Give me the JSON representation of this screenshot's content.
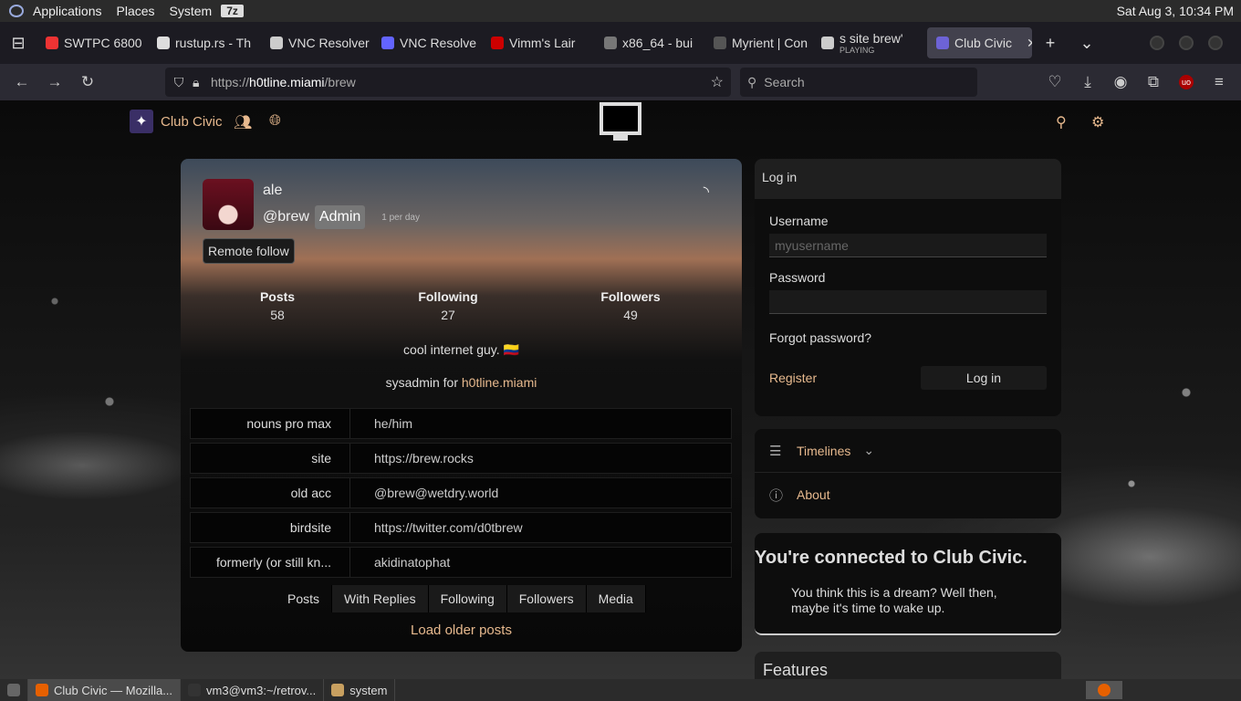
{
  "os_panel": {
    "menus": [
      "Applications",
      "Places",
      "System"
    ],
    "seven_z": "7z",
    "clock": "Sat Aug  3, 10:34 PM"
  },
  "tabs": [
    {
      "label": "SWTPC 6800",
      "color": "#e33"
    },
    {
      "label": "rustup.rs - Th",
      "color": "#ddd"
    },
    {
      "label": "VNC Resolver",
      "color": "#ccc"
    },
    {
      "label": "VNC Resolve",
      "color": "#6364ff"
    },
    {
      "label": "Vimm's Lair",
      "color": "#c00"
    },
    {
      "label": "x86_64 - bui",
      "color": "#777"
    },
    {
      "label": "Myrient | Con",
      "color": "#555"
    },
    {
      "label": "s site brew'",
      "sub": "PLAYING",
      "color": "#ccc"
    },
    {
      "label": "Club Civic",
      "color": "#6d63d6",
      "active": true
    }
  ],
  "navbar": {
    "url_prefix": "https://",
    "url_host": "h0tline.miami",
    "url_path": "/brew",
    "search_placeholder": "Search"
  },
  "site": {
    "brand": "Club Civic"
  },
  "profile": {
    "name": "ale",
    "handle": "@brew",
    "role": "Admin",
    "rate": "1 per day",
    "remote_follow": "Remote follow",
    "stats": [
      {
        "label": "Posts",
        "value": "58"
      },
      {
        "label": "Following",
        "value": "27"
      },
      {
        "label": "Followers",
        "value": "49"
      }
    ],
    "bio_line1": "cool internet guy. 🇨🇴",
    "bio_line2_prefix": "sysadmin for ",
    "bio_line2_link": "h0tline.miami",
    "fields": [
      {
        "key": "nouns pro max",
        "value": "he/him",
        "link": false
      },
      {
        "key": "site",
        "value": "https://brew.rocks",
        "link": true
      },
      {
        "key": "old acc",
        "value": "@brew@wetdry.world",
        "link": true
      },
      {
        "key": "birdsite",
        "value": "https://twitter.com/d0tbrew",
        "link": true
      },
      {
        "key": "formerly (or still kn...",
        "value": "akidinatophat",
        "link": false
      }
    ],
    "tabs": [
      "Posts",
      "With Replies",
      "Following",
      "Followers",
      "Media"
    ],
    "load_older": "Load older posts"
  },
  "login": {
    "title": "Log in",
    "username_label": "Username",
    "username_placeholder": "myusername",
    "password_label": "Password",
    "forgot": "Forgot password?",
    "register": "Register",
    "submit": "Log in"
  },
  "sidebar": {
    "timelines": "Timelines",
    "about": "About"
  },
  "connected": {
    "title": "You're connected to Club Civic.",
    "text": "You think this is a dream? Well then, maybe it's time to wake up."
  },
  "features": {
    "title": "Features"
  },
  "taskbar": [
    {
      "label": "Club Civic — Mozilla...",
      "active": true
    },
    {
      "label": "vm3@vm3:~/retrov..."
    },
    {
      "label": "system"
    }
  ]
}
